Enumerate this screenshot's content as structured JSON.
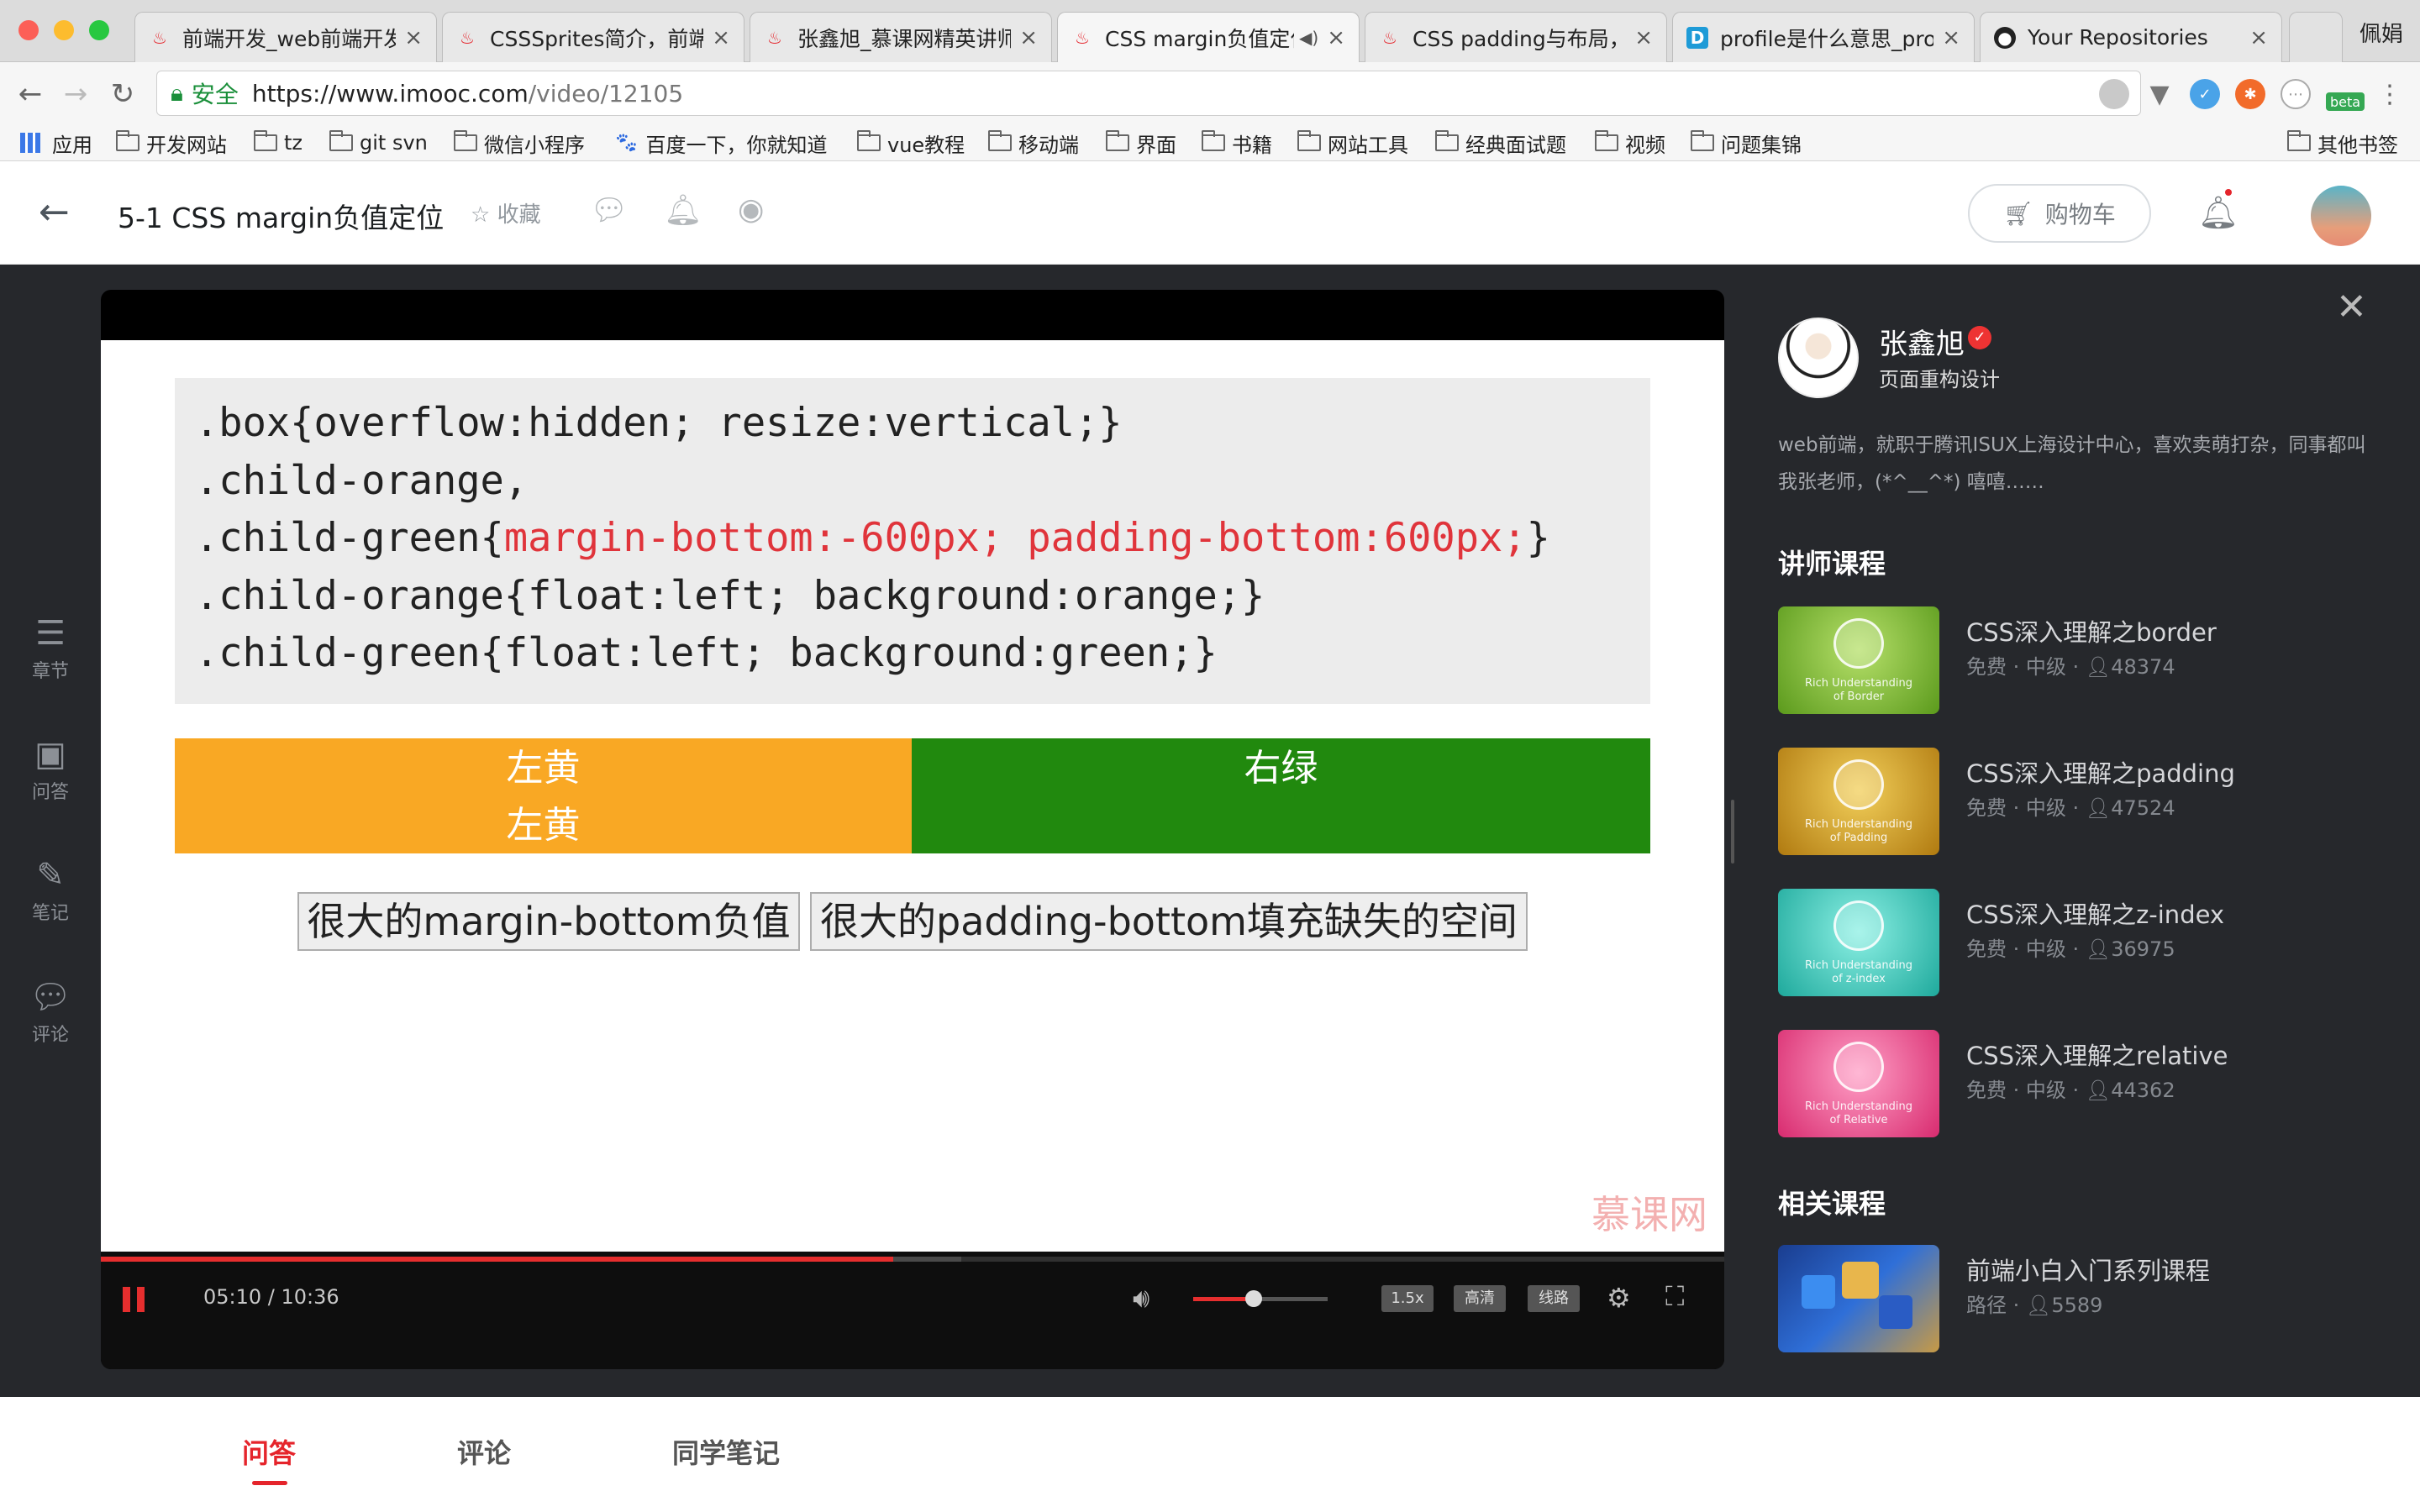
{
  "browser": {
    "tabs": [
      {
        "title": "前端开发_web前端开发",
        "favicon": "flame"
      },
      {
        "title": "CSSSprites简介，前端",
        "favicon": "flame"
      },
      {
        "title": "张鑫旭_慕课网精英讲师",
        "favicon": "flame"
      },
      {
        "title": "CSS margin负值定位",
        "favicon": "flame",
        "active": true
      },
      {
        "title": "CSS padding与布局，C",
        "favicon": "flame"
      },
      {
        "title": "profile是什么意思_profi",
        "favicon": "d-logo"
      },
      {
        "title": "Your Repositories",
        "favicon": "github"
      }
    ],
    "user_name": "佩娟",
    "address": {
      "secure_label": "安全",
      "host": "https://www.imooc.com",
      "path": "/video/12105"
    },
    "bookmarks": [
      "应用",
      "开发网站",
      "tz",
      "git svn",
      "微信小程序",
      "百度一下，你就知道",
      "vue教程",
      "移动端",
      "界面",
      "书籍",
      "网站工具",
      "经典面试题",
      "视频",
      "问题集锦",
      "其他书签"
    ],
    "ext_badge": "beta"
  },
  "header": {
    "title": "5-1 CSS margin负值定位",
    "favorite_label": "收藏",
    "cart_label": "购物车"
  },
  "left_nav": [
    {
      "label": "章节",
      "icon": "menu-icon"
    },
    {
      "label": "问答",
      "icon": "qa-icon"
    },
    {
      "label": "笔记",
      "icon": "pencil-icon"
    },
    {
      "label": "评论",
      "icon": "comment-icon"
    }
  ],
  "slide": {
    "code": {
      "line1": ".box{overflow:hidden; resize:vertical;}",
      "line2": ".child-orange,",
      "line3_pre": ".child-green{",
      "line3_red": "margin-bottom:-600px; padding-bottom:600px;",
      "line3_post": "}",
      "line4": ".child-orange{float:left; background:orange;}",
      "line5": ".child-green{float:left; background:green;}"
    },
    "orange_line1": "左黄",
    "orange_line2": "左黄",
    "green_label": "右绿",
    "button1": "很大的margin-bottom负值",
    "button2": "很大的padding-bottom填充缺失的空间",
    "watermark": "慕课网"
  },
  "player": {
    "time": "05:10 / 10:36",
    "progress": 0.488,
    "buffered": 0.53,
    "volume": 0.45,
    "speed": "1.5x",
    "quality": "高清",
    "line": "线路"
  },
  "teacher": {
    "name": "张鑫旭",
    "title": "页面重构设计",
    "bio": "web前端，就职于腾讯ISUX上海设计中心，喜欢卖萌打杂，同事都叫我张老师，(*^__^*) 嘻嘻……"
  },
  "teacher_courses_heading": "讲师课程",
  "teacher_courses": [
    {
      "name": "CSS深入理解之border",
      "meta": "免费 · 中级 · ",
      "count": "48374",
      "cap1": "Rich Understanding",
      "cap2": "of Border",
      "color": "#7ab52a"
    },
    {
      "name": "CSS深入理解之padding",
      "meta": "免费 · 中级 · ",
      "count": "47524",
      "cap1": "Rich Understanding",
      "cap2": "of Padding",
      "color": "#d9a21a"
    },
    {
      "name": "CSS深入理解之z-index",
      "meta": "免费 · 中级 · ",
      "count": "36975",
      "cap1": "Rich Understanding",
      "cap2": "of z-index",
      "color": "#3ec9bd"
    },
    {
      "name": "CSS深入理解之relative",
      "meta": "免费 · 中级 · ",
      "count": "44362",
      "cap1": "Rich Understanding",
      "cap2": "of Relative",
      "color": "#ea4b86"
    }
  ],
  "related_heading": "相关课程",
  "related_courses": [
    {
      "name": "前端小白入门系列课程",
      "meta": "路径 · ",
      "count": "5589"
    }
  ],
  "bottom_tabs": [
    "问答",
    "评论",
    "同学笔记"
  ]
}
